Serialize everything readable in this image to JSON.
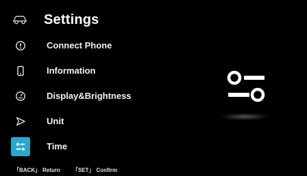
{
  "header": {
    "icon": "car-icon",
    "title": "Settings"
  },
  "menu": {
    "items": [
      {
        "id": "connect-phone",
        "label": "Connect Phone",
        "icon": "info-circle-icon",
        "selected": false
      },
      {
        "id": "information",
        "label": "Information",
        "icon": "phone-device-icon",
        "selected": false
      },
      {
        "id": "display-brightness",
        "label": "Display&Brightness",
        "icon": "gauge-icon",
        "selected": false
      },
      {
        "id": "unit",
        "label": "Unit",
        "icon": "navigation-arrow-icon",
        "selected": false
      },
      {
        "id": "time",
        "label": "Time",
        "icon": "sliders-toggle-icon",
        "selected": true
      }
    ]
  },
  "preview": {
    "icon": "sliders-toggle-icon"
  },
  "footer": {
    "back_key": "「BACK」",
    "back_action": "Return",
    "set_key": "「SET」",
    "set_action": "Confirm"
  },
  "colors": {
    "background": "#000000",
    "accent": "#2aa7cd",
    "text": "#ffffff"
  }
}
